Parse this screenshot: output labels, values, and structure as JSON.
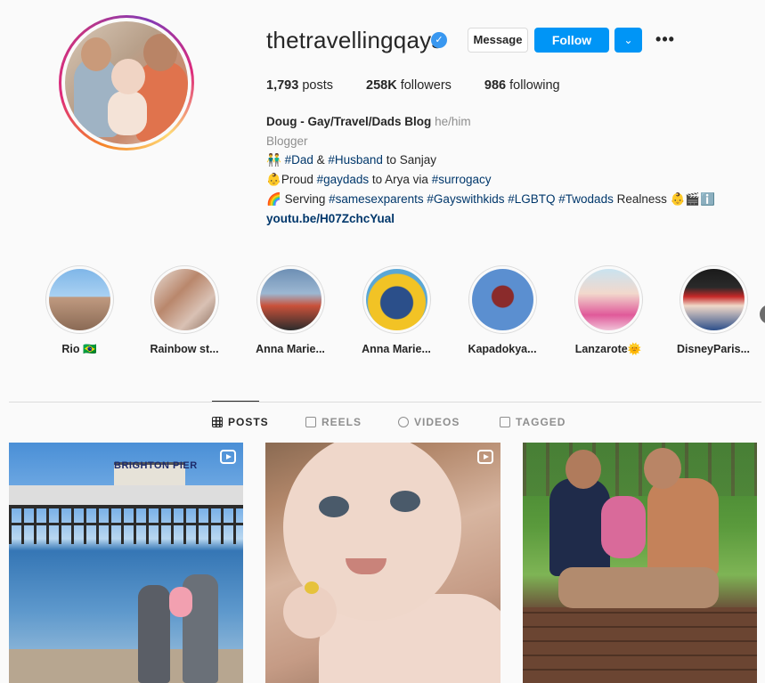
{
  "profile": {
    "username": "thetravellingqays",
    "verified_mark": "✓",
    "message_label": "Message",
    "follow_label": "Follow",
    "suggest_chevron": "⌄",
    "more_label": "•••",
    "stats": {
      "posts_count": "1,793",
      "posts_label": "posts",
      "followers_count": "258K",
      "followers_label": "followers",
      "following_count": "986",
      "following_label": "following"
    },
    "bio": {
      "name": "Doug - Gay/Travel/Dads Blog",
      "pronouns": "he/him",
      "category": "Blogger",
      "line1_emoji": "👬",
      "line1_a": "#Dad",
      "line1_b": " & ",
      "line1_c": "#Husband",
      "line1_d": " to Sanjay",
      "line2_emoji": "👶",
      "line2_a": "Proud ",
      "line2_b": "#gaydads",
      "line2_c": " to Arya via ",
      "line2_d": "#surrogacy",
      "line3_emoji": "🌈",
      "line3_a": " Serving ",
      "line3_b": "#samesexparents",
      "line3_c": " ",
      "line3_d": "#Gayswithkids",
      "line3_e": " ",
      "line3_f": "#LGBTQ",
      "line3_g": " ",
      "line3_h": "#Twodads",
      "line3_i": " Realness 👶🎬ℹ️",
      "link": "youtu.be/H07ZchcYual"
    }
  },
  "highlights": [
    {
      "label": "Rio 🇧🇷",
      "icon": "highlight-photo"
    },
    {
      "label": "Rainbow st...",
      "icon": "highlight-photo"
    },
    {
      "label": "Anna Marie...",
      "icon": "highlight-photo"
    },
    {
      "label": "Anna Marie...",
      "icon": "highlight-photo"
    },
    {
      "label": "Kapadokya...",
      "icon": "highlight-photo"
    },
    {
      "label": "Lanzarote🌞",
      "icon": "highlight-photo"
    },
    {
      "label": "DisneyParis...",
      "icon": "highlight-photo"
    }
  ],
  "highlights_next": "›",
  "tabs": [
    {
      "label": "POSTS",
      "icon": "grid-icon",
      "active": true
    },
    {
      "label": "REELS",
      "icon": "reels-icon",
      "active": false
    },
    {
      "label": "VIDEOS",
      "icon": "video-icon",
      "active": false
    },
    {
      "label": "TAGGED",
      "icon": "tagged-icon",
      "active": false
    }
  ],
  "posts": [
    {
      "sign_text": "BRIGHTON PIER",
      "reel": true
    },
    {
      "reel": true
    },
    {
      "reel": false
    }
  ]
}
